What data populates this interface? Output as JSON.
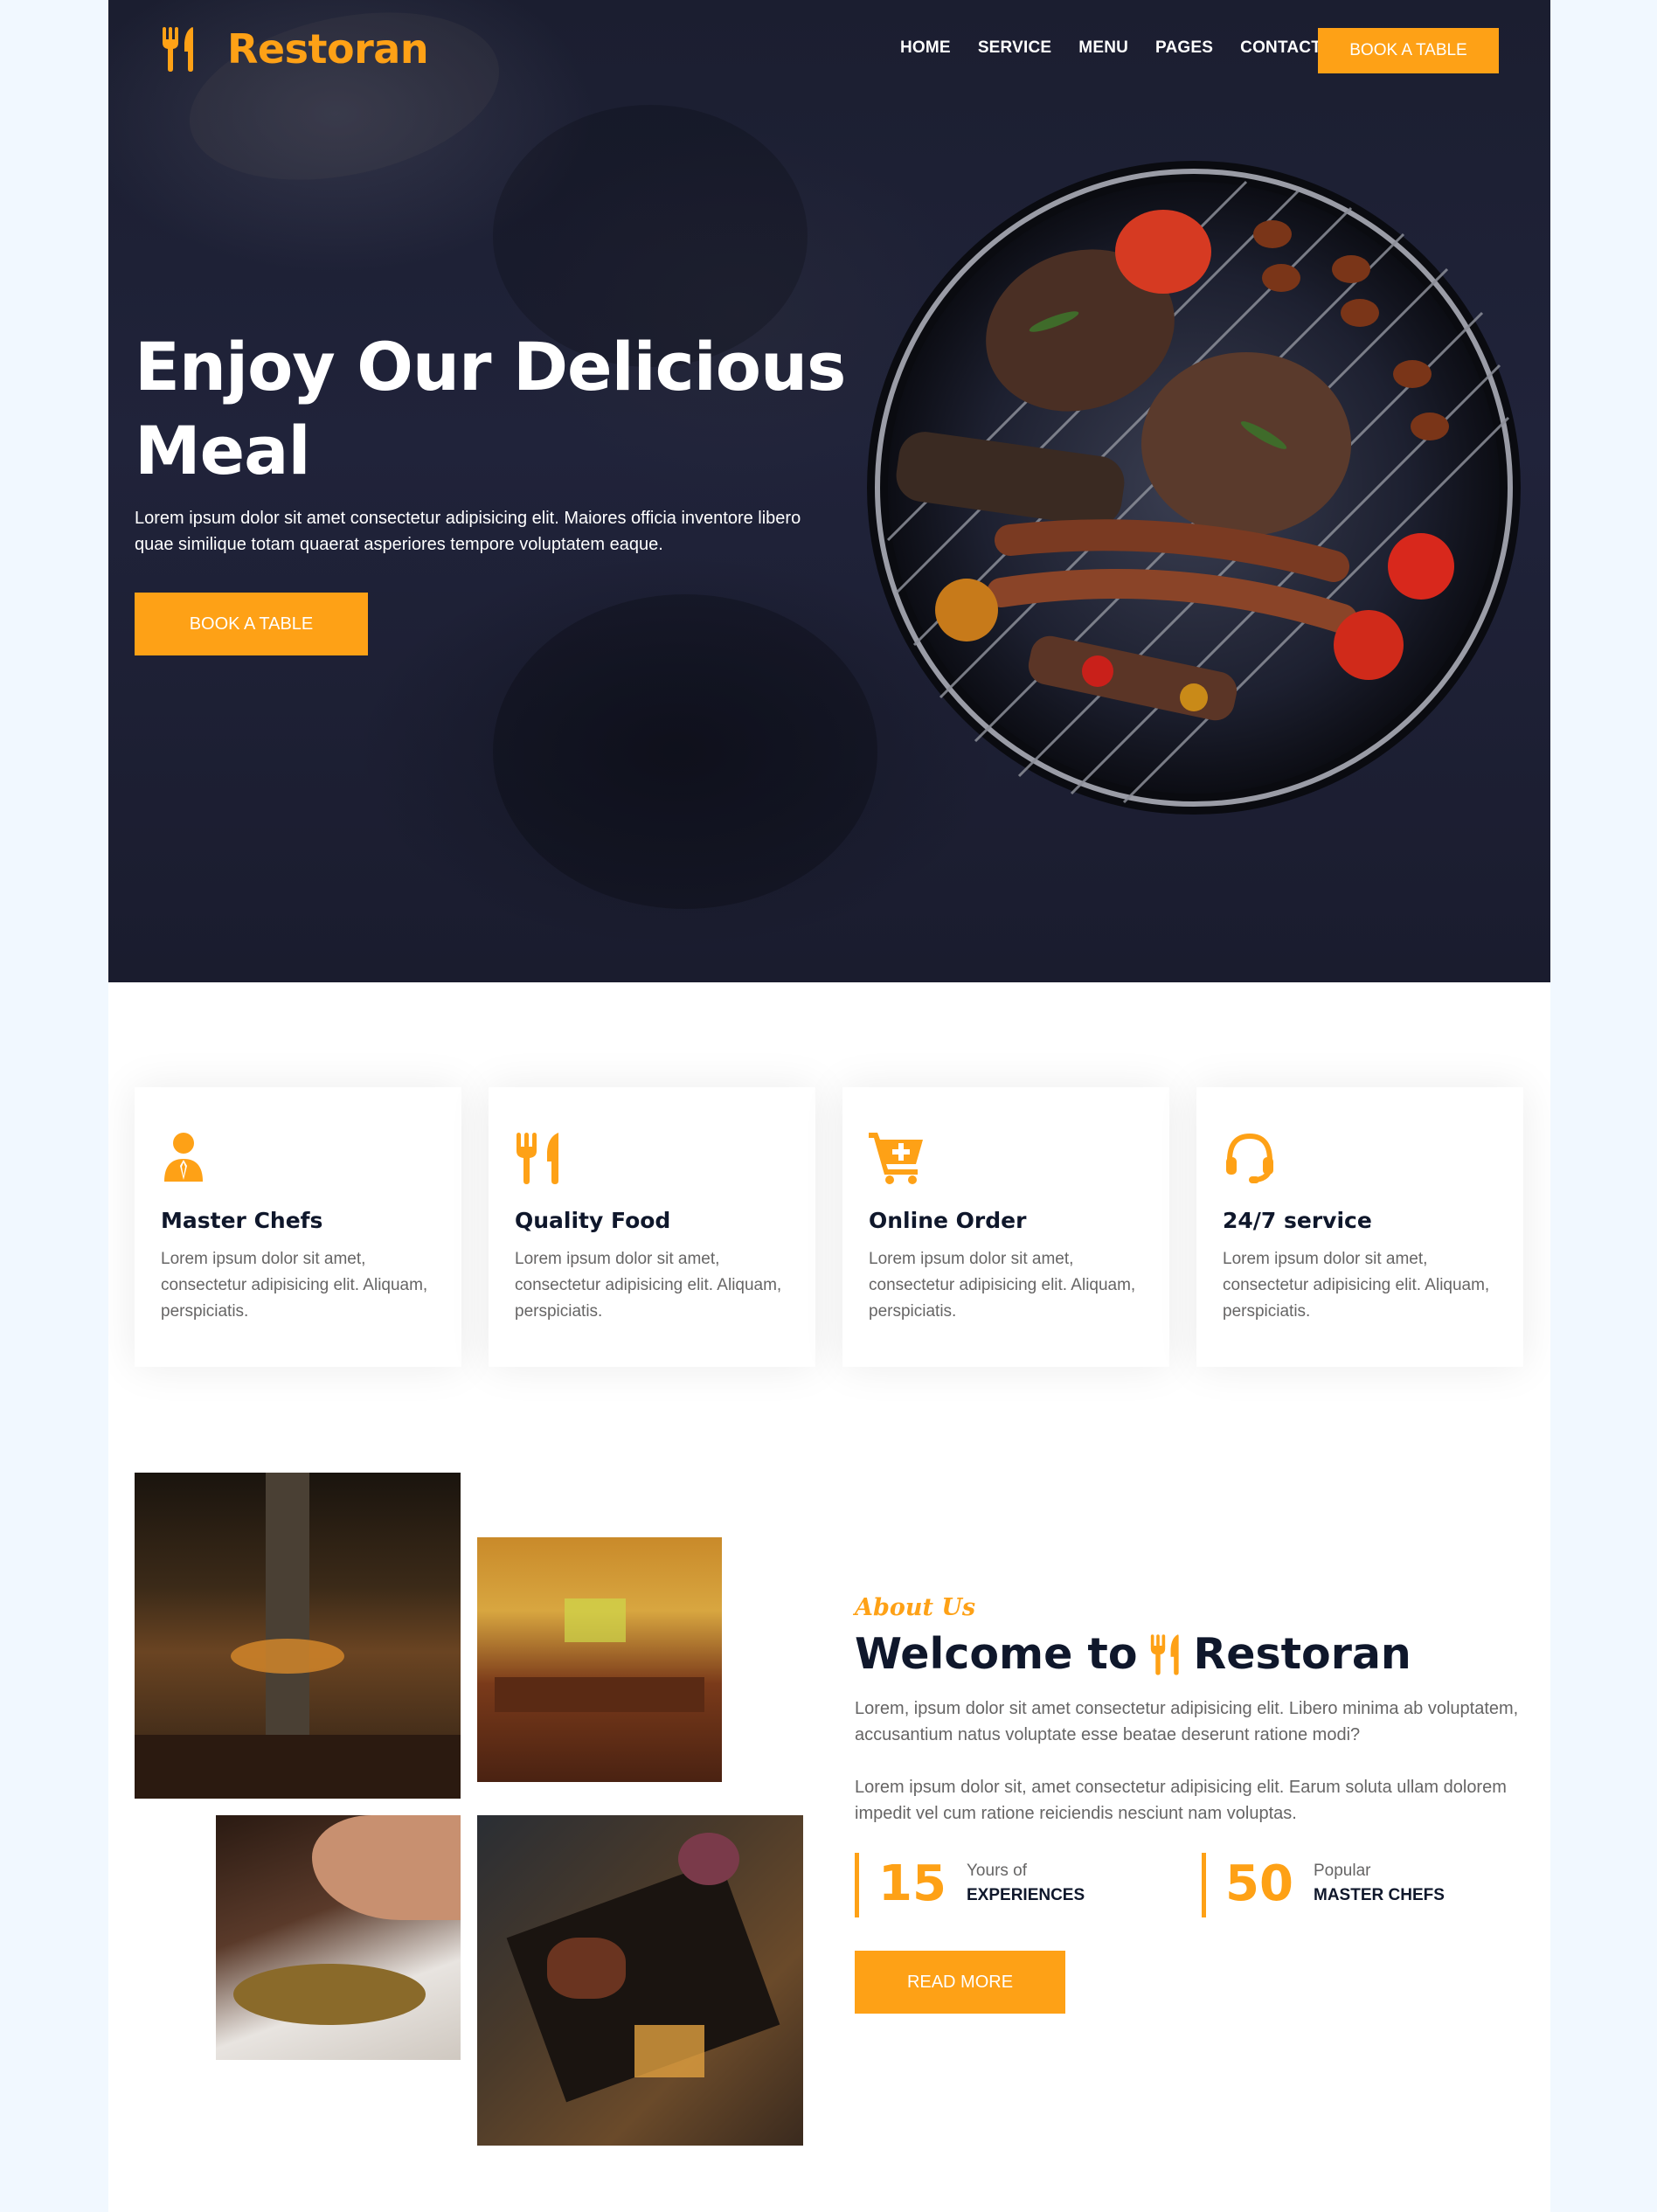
{
  "brand": {
    "name": "Restoran",
    "logo_icon": "utensils-icon",
    "accent": "#FEA116",
    "dark": "#0F172B"
  },
  "nav": {
    "items": [
      {
        "label": "HOME"
      },
      {
        "label": "SERVICE"
      },
      {
        "label": "MENU"
      },
      {
        "label": "PAGES"
      },
      {
        "label": "CONTACT"
      }
    ],
    "book_button": "BOOK A TABLE"
  },
  "hero": {
    "title_line1": "Enjoy Our Delicious",
    "title_line2": "Meal",
    "text": "Lorem ipsum dolor sit amet consectetur adipisicing elit. Maiores officia inventore libero quae similique totam quaerat asperiores tempore voluptatem eaque.",
    "button": "BOOK A TABLE",
    "image": "bbq-grill-image"
  },
  "services": [
    {
      "icon": "chef-icon",
      "title": "Master Chefs",
      "text": "Lorem ipsum dolor sit amet, consectetur adipisicing elit. Aliquam, perspiciatis."
    },
    {
      "icon": "utensils-icon",
      "title": "Quality Food",
      "text": "Lorem ipsum dolor sit amet, consectetur adipisicing elit. Aliquam, perspiciatis."
    },
    {
      "icon": "cart-plus-icon",
      "title": "Online Order",
      "text": "Lorem ipsum dolor sit amet, consectetur adipisicing elit. Aliquam, perspiciatis."
    },
    {
      "icon": "headset-icon",
      "title": "24/7 service",
      "text": "Lorem ipsum dolor sit amet, consectetur adipisicing elit. Aliquam, perspiciatis."
    }
  ],
  "about": {
    "subtitle": "About Us",
    "title_prefix": "Welcome to",
    "title_brand": "Restoran",
    "paragraph1": "Lorem, ipsum dolor sit amet consectetur adipisicing elit. Libero minima ab voluptatem, accusantium natus voluptate esse beatae deserunt ratione modi?",
    "paragraph2": "Lorem ipsum dolor sit, amet consectetur adipisicing elit. Earum soluta ullam dolorem impedit vel cum ratione reiciendis nesciunt nam voluptas.",
    "stats": [
      {
        "number": "15",
        "small": "Yours of",
        "big": "EXPERIENCES"
      },
      {
        "number": "50",
        "small": "Popular",
        "big": "MASTER CHEFS"
      }
    ],
    "button": "READ MORE",
    "photos": [
      "restaurant-interior-photo",
      "dining-room-photo",
      "salad-plate-photo",
      "food-platter-photo"
    ]
  }
}
